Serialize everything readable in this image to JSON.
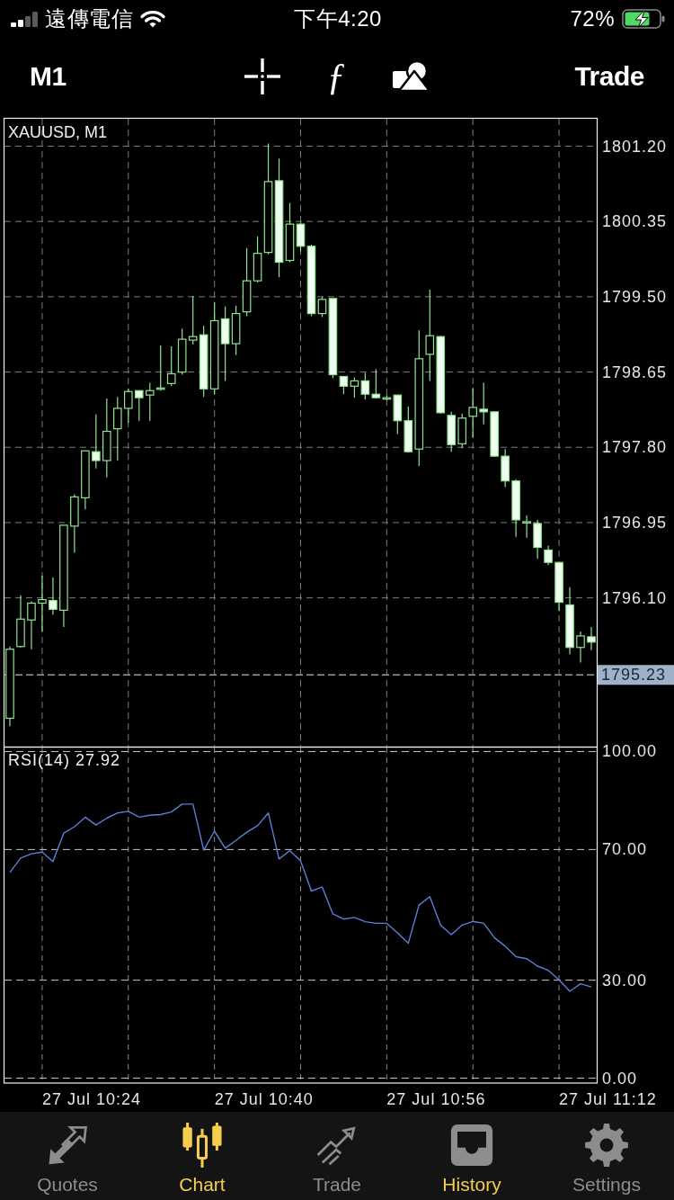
{
  "status_bar": {
    "carrier": "遠傳電信",
    "time": "下午4:20",
    "battery": "72%"
  },
  "toolbar": {
    "timeframe": "M1",
    "indicator_symbol": "ƒ",
    "trade": "Trade"
  },
  "price_chart": {
    "chart_data": {
      "type": "candlestick",
      "title": "XAUUSD, M1",
      "grid": true,
      "categories": [
        null,
        null,
        null,
        null,
        null,
        null,
        null,
        null,
        null,
        null,
        null,
        null,
        null,
        null,
        null,
        null,
        null,
        null,
        null,
        null,
        null,
        null,
        null,
        null,
        null,
        null,
        null,
        null,
        null,
        null,
        null,
        null,
        null,
        null,
        null,
        null,
        null,
        null,
        null,
        null,
        null,
        null,
        null,
        null,
        null,
        null,
        null,
        null,
        null,
        null,
        null,
        null,
        null,
        null,
        null
      ],
      "ohlc": [
        [
          1794.74,
          1795.55,
          1794.65,
          1795.52
        ],
        [
          1795.55,
          1796.13,
          1795.54,
          1795.86
        ],
        [
          1795.85,
          1796.06,
          1795.52,
          1796.04
        ],
        [
          1796.04,
          1796.35,
          1795.72,
          1796.08
        ],
        [
          1796.07,
          1796.33,
          1795.91,
          1795.97
        ],
        [
          1795.96,
          1796.92,
          1795.77,
          1796.92
        ],
        [
          1796.91,
          1797.27,
          1796.61,
          1797.24
        ],
        [
          1797.23,
          1797.76,
          1797.1,
          1797.76
        ],
        [
          1797.75,
          1798.17,
          1797.56,
          1797.65
        ],
        [
          1797.65,
          1798.35,
          1797.46,
          1797.98
        ],
        [
          1798.01,
          1798.37,
          1797.65,
          1798.24
        ],
        [
          1798.24,
          1798.46,
          1798.08,
          1798.43
        ],
        [
          1798.44,
          1798.44,
          1798.1,
          1798.36
        ],
        [
          1798.39,
          1798.53,
          1798.1,
          1798.44
        ],
        [
          1798.47,
          1798.95,
          1798.44,
          1798.47
        ],
        [
          1798.52,
          1798.94,
          1798.49,
          1798.63
        ],
        [
          1798.65,
          1799.14,
          1798.62,
          1799.02
        ],
        [
          1799.01,
          1799.51,
          1798.96,
          1799.05
        ],
        [
          1799.07,
          1799.17,
          1798.37,
          1798.46
        ],
        [
          1798.46,
          1799.44,
          1798.4,
          1799.23
        ],
        [
          1799.25,
          1799.39,
          1798.55,
          1798.97
        ],
        [
          1798.97,
          1799.4,
          1798.84,
          1799.31
        ],
        [
          1799.33,
          1800.05,
          1799.28,
          1799.68
        ],
        [
          1799.68,
          1800.18,
          1799.66,
          1799.99
        ],
        [
          1800.0,
          1801.23,
          1799.98,
          1800.8
        ],
        [
          1800.81,
          1801.06,
          1799.72,
          1799.89
        ],
        [
          1799.91,
          1800.56,
          1799.89,
          1800.32
        ],
        [
          1800.32,
          1800.34,
          1800.01,
          1800.07
        ],
        [
          1800.07,
          1800.09,
          1799.28,
          1799.31
        ],
        [
          1799.31,
          1799.5,
          1799.27,
          1799.47
        ],
        [
          1799.48,
          1799.48,
          1798.58,
          1798.62
        ],
        [
          1798.6,
          1798.6,
          1798.4,
          1798.49
        ],
        [
          1798.49,
          1798.59,
          1798.36,
          1798.55
        ],
        [
          1798.55,
          1798.64,
          1798.34,
          1798.4
        ],
        [
          1798.4,
          1798.68,
          1798.35,
          1798.36
        ],
        [
          1798.36,
          1798.39,
          1798.33,
          1798.36
        ],
        [
          1798.39,
          1798.39,
          1797.95,
          1798.1
        ],
        [
          1798.1,
          1798.26,
          1797.74,
          1797.75
        ],
        [
          1797.78,
          1799.12,
          1797.59,
          1798.8
        ],
        [
          1798.85,
          1799.58,
          1798.55,
          1799.06
        ],
        [
          1799.05,
          1799.06,
          1798.18,
          1798.19
        ],
        [
          1798.16,
          1798.2,
          1797.75,
          1797.83
        ],
        [
          1797.84,
          1798.18,
          1797.79,
          1798.13
        ],
        [
          1798.15,
          1798.47,
          1797.91,
          1798.25
        ],
        [
          1798.23,
          1798.53,
          1798.06,
          1798.2
        ],
        [
          1798.2,
          1798.21,
          1797.69,
          1797.7
        ],
        [
          1797.7,
          1797.78,
          1797.35,
          1797.42
        ],
        [
          1797.42,
          1797.44,
          1796.79,
          1796.98
        ],
        [
          1796.96,
          1797.03,
          1796.78,
          1796.96
        ],
        [
          1796.94,
          1796.98,
          1796.54,
          1796.67
        ],
        [
          1796.64,
          1796.69,
          1796.47,
          1796.5
        ],
        [
          1796.5,
          1796.5,
          1795.95,
          1796.05
        ],
        [
          1796.02,
          1796.22,
          1795.46,
          1795.54
        ],
        [
          1795.54,
          1795.72,
          1795.37,
          1795.67
        ],
        [
          1795.66,
          1795.77,
          1795.51,
          1795.6
        ]
      ],
      "ylim": [
        1794.42,
        1801.51
      ],
      "yticks": [
        {
          "value": 1801.2,
          "label": "1801.20"
        },
        {
          "value": 1800.35,
          "label": "1800.35"
        },
        {
          "value": 1799.5,
          "label": "1799.50"
        },
        {
          "value": 1798.65,
          "label": "1798.65"
        },
        {
          "value": 1797.8,
          "label": "1797.80"
        },
        {
          "value": 1796.95,
          "label": "1796.95"
        },
        {
          "value": 1796.1,
          "label": "1796.10"
        }
      ],
      "ref_lines": [
        {
          "axis": "y",
          "value": 1795.23,
          "label": "1795.23"
        }
      ]
    }
  },
  "rsi_chart": {
    "reading": "27.92",
    "chart_data": {
      "type": "line",
      "grid": true,
      "categories": [
        null,
        null,
        null,
        null,
        null,
        null,
        null,
        null,
        null,
        null,
        null,
        null,
        null,
        null,
        null,
        null,
        null,
        null,
        null,
        null,
        null,
        null,
        null,
        null,
        null,
        null,
        null,
        null,
        null,
        null,
        null,
        null,
        null,
        null,
        null,
        null,
        null,
        null,
        null,
        null,
        null,
        null,
        null,
        null,
        null,
        null,
        null,
        null,
        null,
        null,
        null,
        null,
        null,
        null,
        null
      ],
      "series": [
        {
          "name": "RSI(14)",
          "color": "#5b7fd6",
          "values": [
            63.0,
            67.4,
            68.7,
            69.2,
            66.3,
            75.0,
            77.0,
            79.9,
            77.5,
            79.6,
            81.2,
            81.7,
            79.9,
            80.5,
            80.7,
            81.5,
            83.9,
            83.9,
            69.8,
            75.6,
            70.4,
            72.8,
            75.3,
            77.3,
            81.2,
            67.1,
            69.6,
            66.5,
            57.3,
            58.5,
            50.3,
            48.7,
            49.2,
            47.9,
            47.4,
            47.4,
            44.5,
            41.3,
            53.0,
            55.6,
            46.8,
            43.9,
            46.9,
            48.0,
            47.4,
            43.0,
            40.4,
            37.2,
            36.6,
            34.3,
            33.0,
            30.1,
            26.6,
            28.9,
            27.9
          ]
        }
      ],
      "ylim": [
        -1.5,
        101.5
      ],
      "yticks": [
        {
          "value": 100,
          "label": "100.00"
        },
        {
          "value": 70,
          "label": "70.00"
        },
        {
          "value": 30,
          "label": "30.00"
        },
        {
          "value": 0,
          "label": "0.00"
        }
      ]
    }
  },
  "time_axis": {
    "labels": [
      "27 Jul 10:24",
      "27 Jul 10:40",
      "27 Jul 10:56",
      "27 Jul 11:12"
    ]
  },
  "tab_bar": [
    {
      "label": "Quotes",
      "selected": false,
      "highlighted": false
    },
    {
      "label": "Chart",
      "selected": true,
      "highlighted": true
    },
    {
      "label": "Trade",
      "selected": false,
      "highlighted": false
    },
    {
      "label": "History",
      "selected": false,
      "highlighted": true
    },
    {
      "label": "Settings",
      "selected": false,
      "highlighted": false
    }
  ]
}
